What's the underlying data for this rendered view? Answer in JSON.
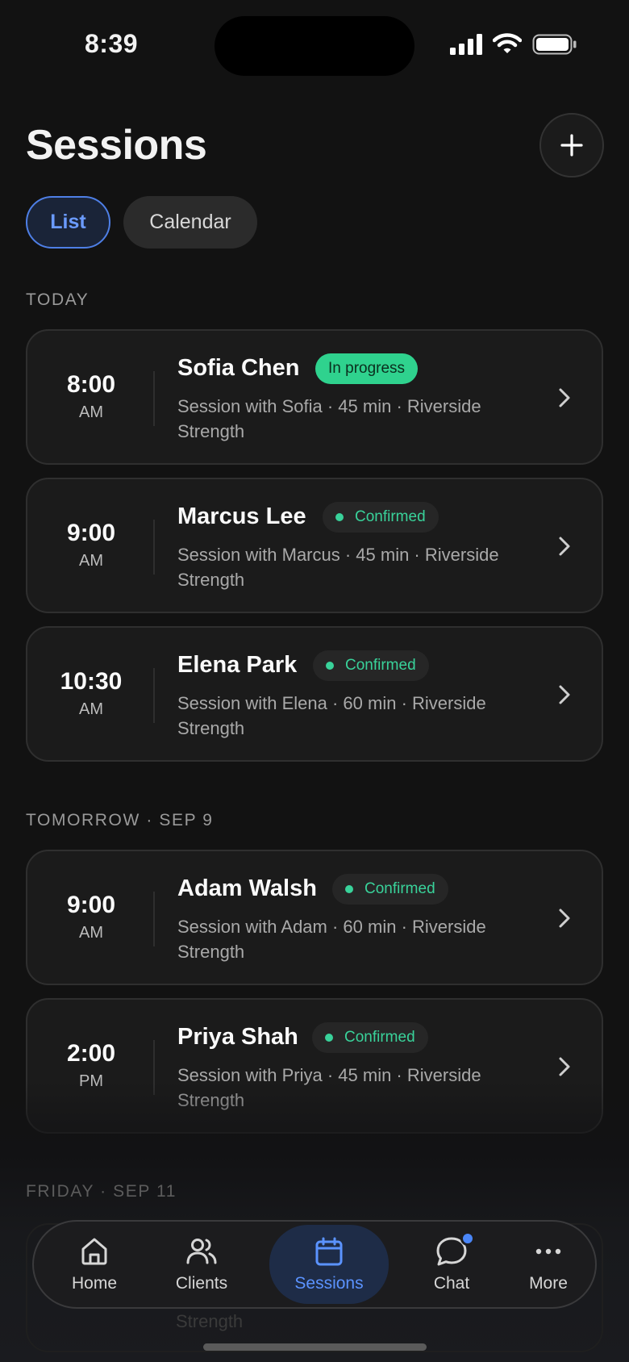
{
  "status_bar": {
    "time": "8:39"
  },
  "header": {
    "title": "Sessions"
  },
  "tabs": [
    {
      "label": "List",
      "active": true
    },
    {
      "label": "Calendar",
      "active": false
    }
  ],
  "sections": [
    {
      "label": "TODAY",
      "sessions": [
        {
          "time": "8:00",
          "ampm": "AM",
          "name": "Sofia Chen",
          "status": "In progress",
          "description": "Session with Sofia · 45 min · Riverside Strength"
        },
        {
          "time": "9:00",
          "ampm": "AM",
          "name": "Marcus Lee",
          "status": "Confirmed",
          "description": "Session with Marcus · 45 min · Riverside Strength"
        },
        {
          "time": "10:30",
          "ampm": "AM",
          "name": "Elena Park",
          "status": "Confirmed",
          "description": "Session with Elena · 60 min · Riverside Strength"
        }
      ]
    },
    {
      "label": "TOMORROW · SEP 9",
      "sessions": [
        {
          "time": "9:00",
          "ampm": "AM",
          "name": "Adam Walsh",
          "status": "Confirmed",
          "description": "Session with Adam · 60 min · Riverside Strength"
        },
        {
          "time": "2:00",
          "ampm": "PM",
          "name": "Priya Shah",
          "status": "Confirmed",
          "description": "Session with Priya · 45 min · Riverside Strength"
        }
      ]
    },
    {
      "label": "FRIDAY · SEP 11",
      "sessions": []
    }
  ],
  "hidden_card_text": "Strength",
  "nav": [
    {
      "label": "Home",
      "icon": "home-icon"
    },
    {
      "label": "Clients",
      "icon": "clients-icon"
    },
    {
      "label": "Sessions",
      "icon": "calendar-icon",
      "active": true
    },
    {
      "label": "Chat",
      "icon": "chat-icon",
      "has_unread": true
    },
    {
      "label": "More",
      "icon": "more-icon"
    }
  ],
  "colors": {
    "accent": "#5b93ff",
    "success": "#39d29a",
    "background": "#121212"
  }
}
